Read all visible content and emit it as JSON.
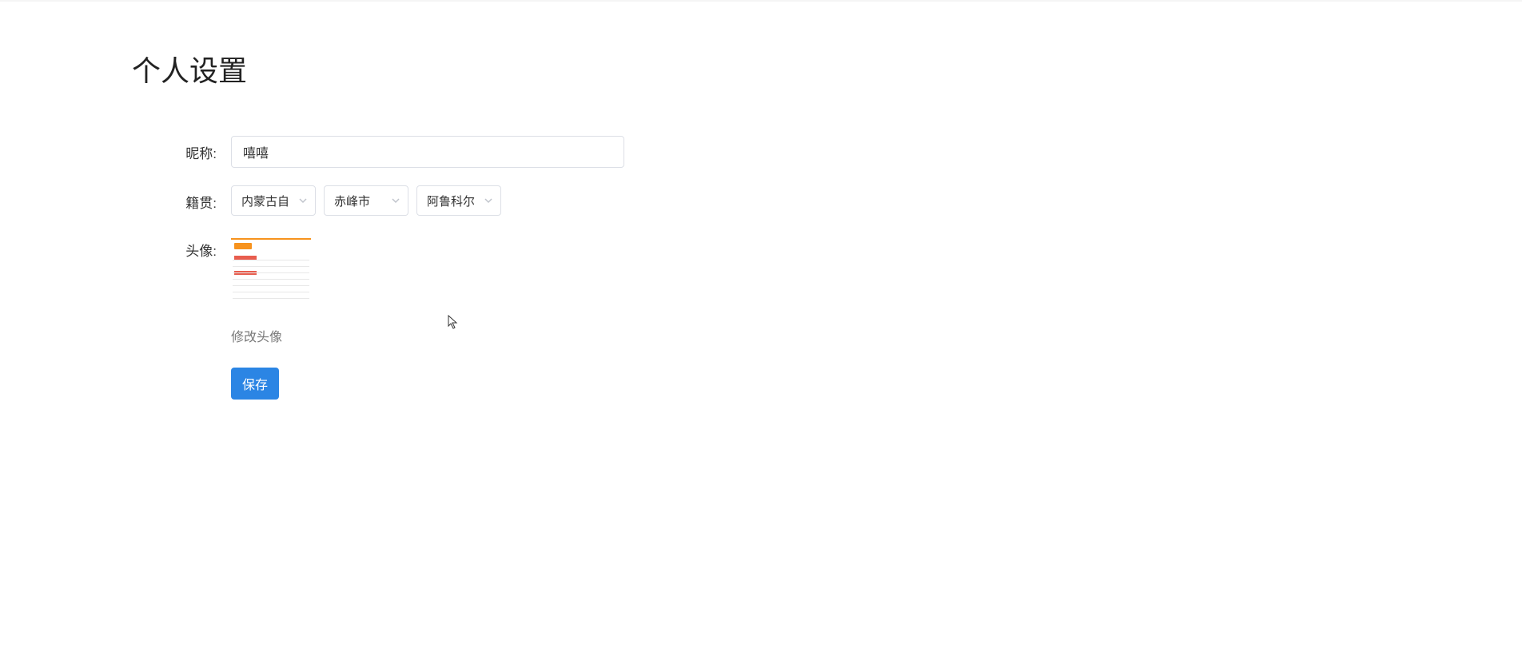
{
  "page": {
    "title": "个人设置"
  },
  "form": {
    "nickname": {
      "label": "昵称:",
      "value": "嘻嘻"
    },
    "hometown": {
      "label": "籍贯:",
      "province": "内蒙古自",
      "city": "赤峰市",
      "district": "阿鲁科尔"
    },
    "avatar": {
      "label": "头像:",
      "change_text": "修改头像"
    },
    "save_label": "保存"
  }
}
